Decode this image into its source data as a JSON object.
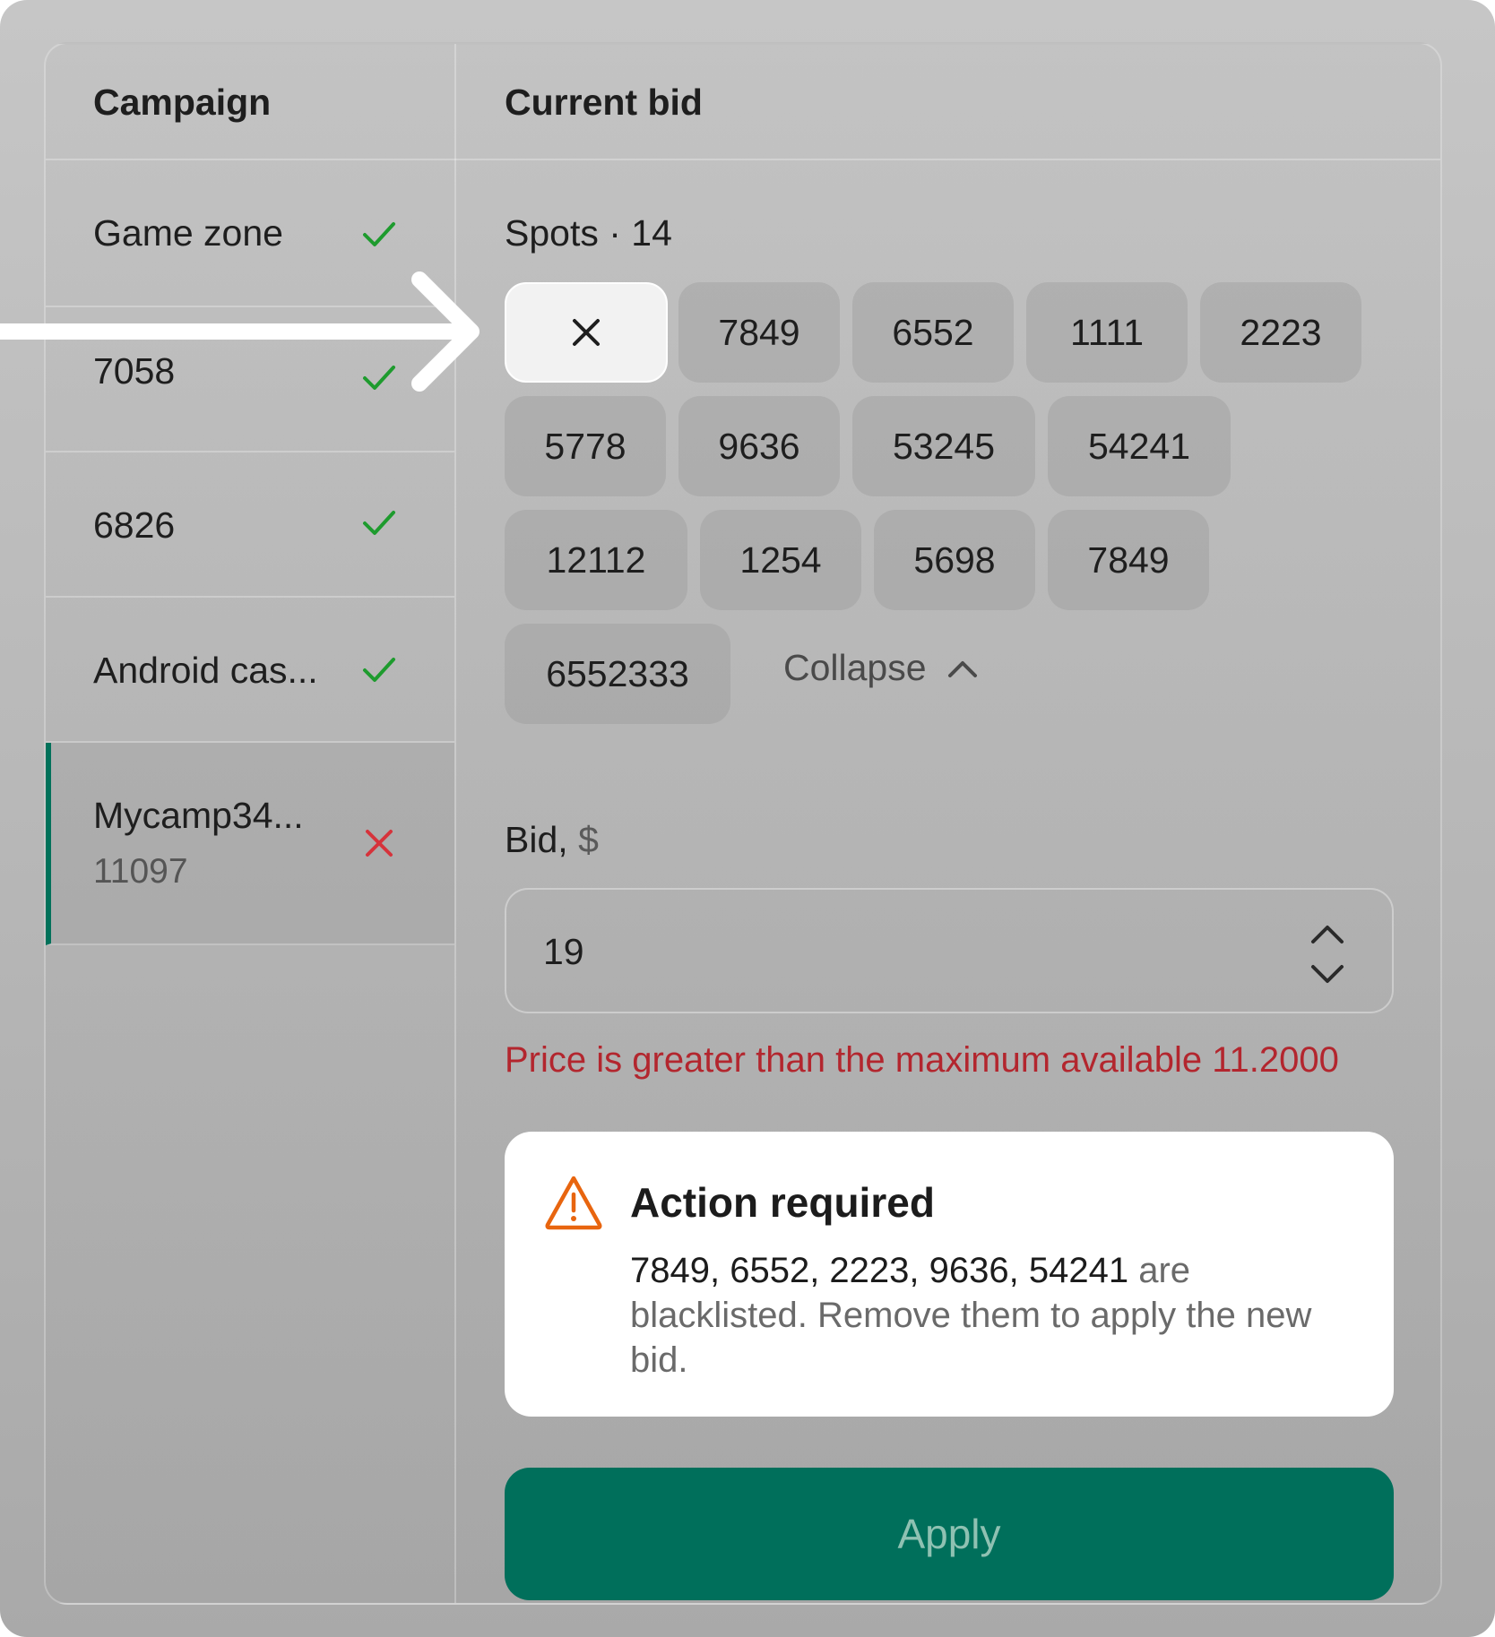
{
  "headers": {
    "campaign": "Campaign",
    "current_bid": "Current bid"
  },
  "campaigns": [
    {
      "name": "Game zone",
      "status": "ok"
    },
    {
      "name": "7058",
      "status": "ok"
    },
    {
      "name": "6826",
      "status": "ok"
    },
    {
      "name": "Android cas...",
      "status": "ok"
    },
    {
      "name": "Mycamp34...",
      "sub": "11097",
      "status": "error"
    }
  ],
  "spots": {
    "label": "Spots · 14",
    "chips": [
      "7849",
      "6552",
      "1111",
      "2223",
      "5778",
      "9636",
      "53245",
      "54241",
      "12112",
      "1254",
      "5698",
      "7849",
      "6552333"
    ],
    "collapse_label": "Collapse"
  },
  "bid": {
    "label": "Bid,",
    "unit": "$",
    "value": "19"
  },
  "error": "Price is greater than the maximum available 11.2000",
  "alert": {
    "title": "Action required",
    "ids": "7849, 6552, 2223, 9636, 54241",
    "message": " are blacklisted. Remove them to apply the new bid."
  },
  "apply_label": "Apply",
  "colors": {
    "accent": "#006f5b",
    "ok": "#1e9b2e",
    "error": "#d6333b",
    "warning": "#e8650f"
  },
  "icons": {
    "ok": "checkmark-icon",
    "error": "cross-icon",
    "remove": "close-icon",
    "collapse": "chevron-up-icon",
    "warning": "warning-triangle-icon"
  }
}
